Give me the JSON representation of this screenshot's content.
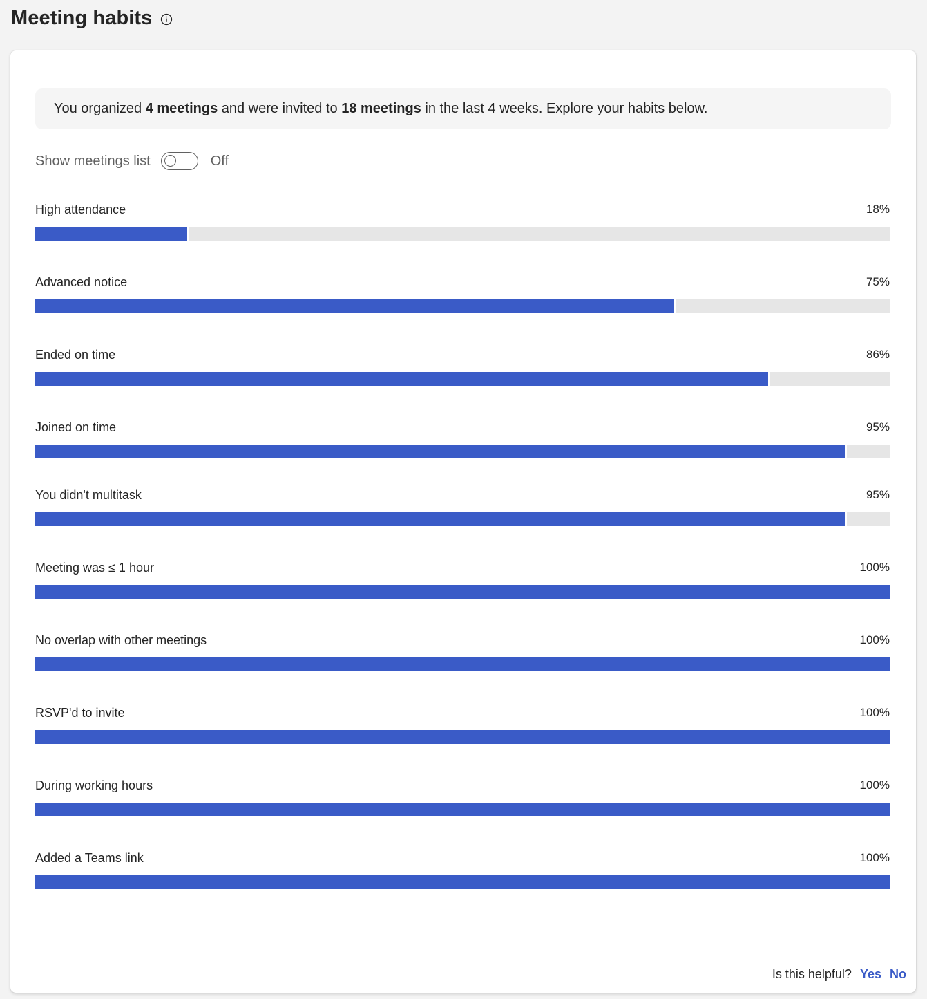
{
  "header": {
    "title": "Meeting habits",
    "info_icon": "info-circle-icon"
  },
  "summary": {
    "part1": "You organized ",
    "organized_count": "4 meetings",
    "part2": " and were invited to ",
    "invited_count": "18 meetings",
    "part3": " in the last 4 weeks. Explore your habits below."
  },
  "toggle": {
    "label": "Show meetings list",
    "state": "Off",
    "on": false
  },
  "colors": {
    "bar_fill": "#3a5bc7",
    "bar_track": "#e6e6e6",
    "link": "#3a5bc7"
  },
  "metrics": [
    {
      "label": "High attendance",
      "value": "18%",
      "percent": 18
    },
    {
      "label": "Advanced notice",
      "value": "75%",
      "percent": 75
    },
    {
      "label": "Ended on time",
      "value": "86%",
      "percent": 86
    },
    {
      "label": "Joined on time",
      "value": "95%",
      "percent": 95
    },
    {
      "label": "You didn't multitask",
      "value": "95%",
      "percent": 95
    },
    {
      "label": "Meeting was ≤ 1 hour",
      "value": "100%",
      "percent": 100
    },
    {
      "label": "No overlap with other meetings",
      "value": "100%",
      "percent": 100
    },
    {
      "label": "RSVP'd to invite",
      "value": "100%",
      "percent": 100
    },
    {
      "label": "During working hours",
      "value": "100%",
      "percent": 100
    },
    {
      "label": "Added a Teams link",
      "value": "100%",
      "percent": 100
    }
  ],
  "feedback": {
    "question": "Is this helpful?",
    "yes": "Yes",
    "no": "No"
  }
}
